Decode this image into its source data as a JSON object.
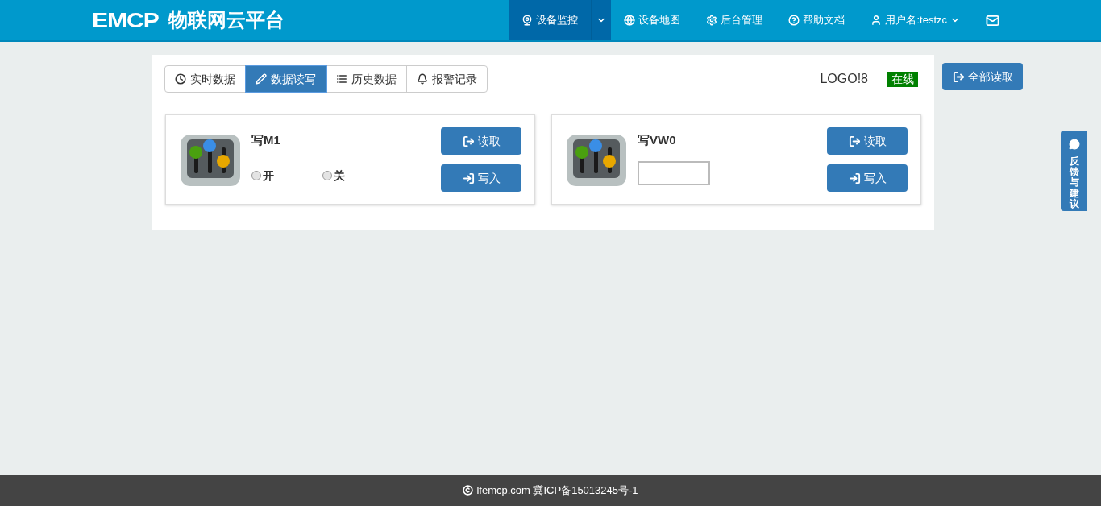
{
  "header": {
    "logo": "EMCP",
    "title": "物联网云平台",
    "nav": [
      {
        "label": "设备监控",
        "kind": "split",
        "selected": true
      },
      {
        "label": "设备地图",
        "kind": "map",
        "selected": false
      },
      {
        "label": "后台管理",
        "kind": "admin",
        "selected": false
      },
      {
        "label": "帮助文档",
        "kind": "help",
        "selected": false
      },
      {
        "label": "用户名:testzc",
        "kind": "user",
        "selected": false
      },
      {
        "kind": "mail",
        "selected": false
      }
    ]
  },
  "tabs": [
    {
      "label": "实时数据",
      "kind": "clock",
      "selected": false
    },
    {
      "label": "数据读写",
      "kind": "pencil",
      "selected": true
    },
    {
      "label": "历史数据",
      "kind": "list",
      "selected": false
    },
    {
      "label": "报警记录",
      "kind": "bell",
      "selected": false
    }
  ],
  "device": {
    "name": "LOGO!8",
    "status": "在线"
  },
  "read_all_button": "全部读取",
  "cards": [
    {
      "title": "写M1",
      "kind": "radio",
      "options": [
        {
          "label": "开",
          "selected": false
        },
        {
          "label": "关",
          "selected": false
        }
      ],
      "read_button": "读取",
      "write_button": "写入"
    },
    {
      "title": "写VW0",
      "kind": "input",
      "read_button": "读取",
      "write_button": "写入"
    }
  ],
  "feedback": "反馈与建议",
  "footer": "lfemcp.com 冀ICP备15013245号-1"
}
